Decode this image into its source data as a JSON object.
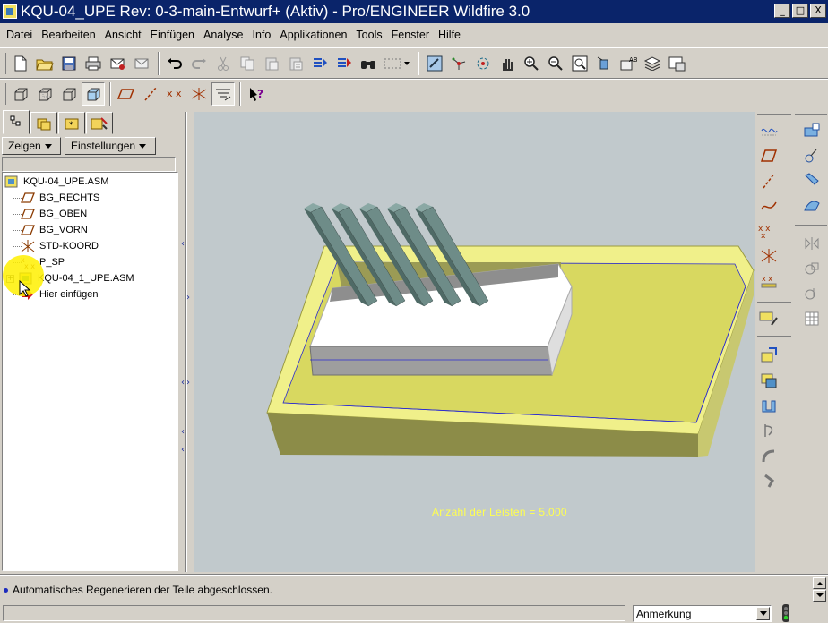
{
  "window": {
    "title": "KQU-04_UPE Rev: 0-3-main-Entwurf+ (Aktiv) - Pro/ENGINEER Wildfire 3.0",
    "minimize": "_",
    "maximize": "□",
    "close": "X"
  },
  "menu": [
    "Datei",
    "Bearbeiten",
    "Ansicht",
    "Einfügen",
    "Analyse",
    "Info",
    "Applikationen",
    "Tools",
    "Fenster",
    "Hilfe"
  ],
  "panel": {
    "show_button": "Zeigen",
    "settings_button": "Einstellungen"
  },
  "tree": [
    {
      "label": "KQU-04_UPE.ASM",
      "icon": "assembly-icon"
    },
    {
      "label": "BG_RECHTS",
      "icon": "datum-plane-icon"
    },
    {
      "label": "BG_OBEN",
      "icon": "datum-plane-icon"
    },
    {
      "label": "BG_VORN",
      "icon": "datum-plane-icon"
    },
    {
      "label": "STD-KOORD",
      "icon": "coordinate-system-icon"
    },
    {
      "label": "P_SP",
      "icon": "datum-point-icon"
    },
    {
      "label": "KQU-04_1_UPE.ASM",
      "icon": "subassembly-icon"
    },
    {
      "label": "Hier einfügen",
      "icon": "insert-here-arrow-icon"
    }
  ],
  "viewport": {
    "annotation": "Anzahl der Leisten  =  5.000",
    "background": "#c1c9cc",
    "tray_color": "#f0f08a",
    "bar_color": "#6e8c88"
  },
  "message": "Automatisches Regenerieren der Teile abgeschlossen.",
  "status": {
    "filter_value": "Anmerkung"
  },
  "colors": {
    "titlebar": "#0a246a",
    "chrome": "#d4d0c8",
    "annotation": "#ffff50"
  }
}
